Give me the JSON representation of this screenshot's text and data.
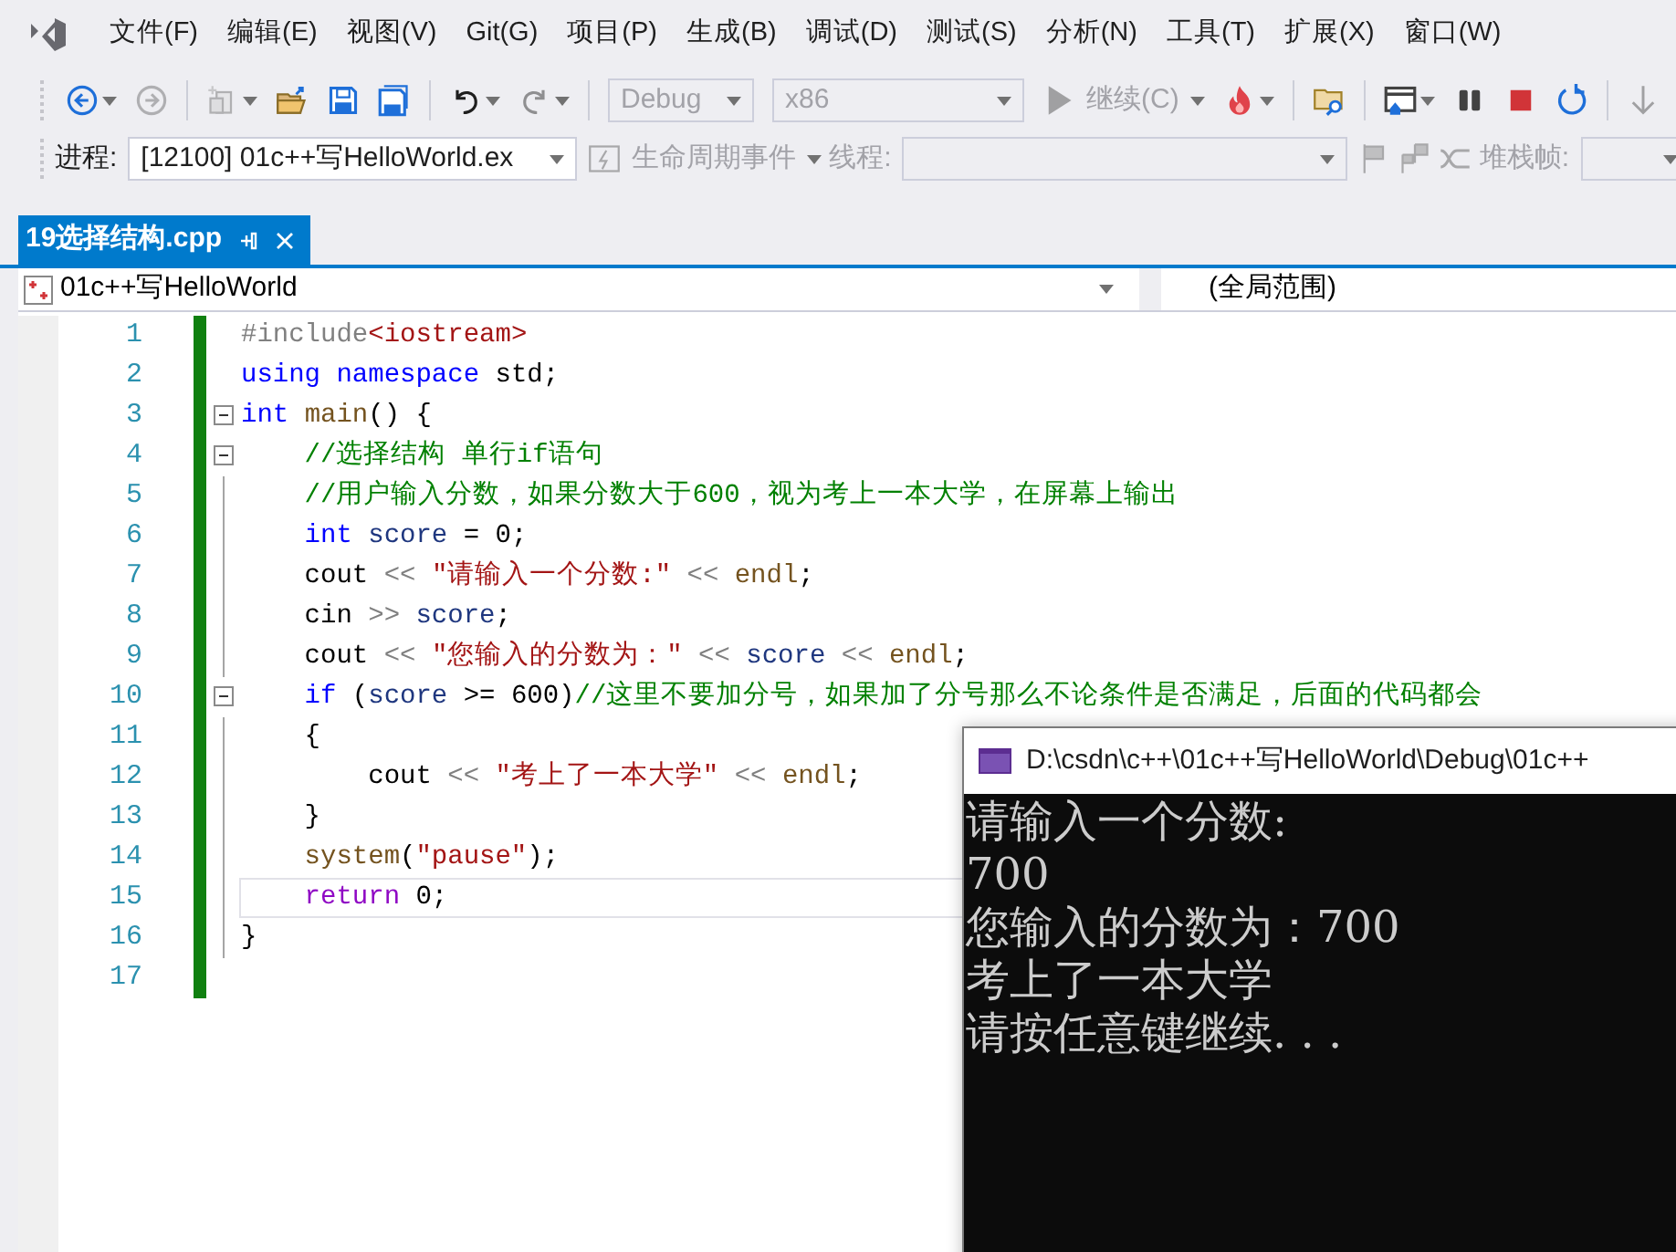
{
  "menu": [
    "文件(F)",
    "编辑(E)",
    "视图(V)",
    "Git(G)",
    "项目(P)",
    "生成(B)",
    "调试(D)",
    "测试(S)",
    "分析(N)",
    "工具(T)",
    "扩展(X)",
    "窗口(W)"
  ],
  "toolbar": {
    "row_1": [
      {
        "kind": "icon",
        "disabled": false,
        "dropdown": true
      },
      {
        "kind": "icon",
        "disabled": true,
        "dropdown": false
      },
      {
        "kind": "separator"
      },
      {
        "kind": "icon",
        "disabled": true,
        "dropdown": true
      },
      {
        "kind": "icon",
        "disabled": false,
        "dropdown": false
      },
      {
        "kind": "icon",
        "disabled": false,
        "dropdown": false
      },
      {
        "kind": "icon",
        "disabled": false,
        "dropdown": false
      },
      {
        "kind": "separator"
      },
      {
        "kind": "icon",
        "disabled": false,
        "dropdown": true
      },
      {
        "kind": "icon",
        "disabled": true,
        "dropdown": true
      },
      {
        "kind": "separator"
      },
      {
        "kind": "select",
        "value": "Debug",
        "disabled": true
      },
      {
        "kind": "select",
        "value": "x86",
        "disabled": true
      },
      {
        "kind": "text-button",
        "label": "继续(C)",
        "disabled": true,
        "dropdown": true
      },
      {
        "kind": "icon",
        "disabled": false,
        "dropdown": true
      },
      {
        "kind": "separator"
      },
      {
        "kind": "icon",
        "disabled": false,
        "dropdown": false
      },
      {
        "kind": "separator"
      },
      {
        "kind": "icon",
        "disabled": false,
        "dropdown": true
      },
      {
        "kind": "icon",
        "disabled": false,
        "dropdown": false
      },
      {
        "kind": "icon",
        "disabled": false,
        "dropdown": false
      },
      {
        "kind": "icon",
        "disabled": false,
        "dropdown": false
      },
      {
        "kind": "separator"
      },
      {
        "kind": "icon",
        "disabled": true,
        "dropdown": false
      }
    ],
    "row_2": [
      {
        "kind": "label",
        "label": "进程:",
        "disabled": false
      },
      {
        "kind": "select",
        "value": "[12100] 01c++写HelloWorld.ex",
        "disabled": false
      },
      {
        "kind": "text-button",
        "label": "生命周期事件",
        "disabled": true,
        "dropdown": true
      },
      {
        "kind": "label",
        "label": "线程:",
        "disabled": true
      },
      {
        "kind": "select",
        "disabled": true
      },
      {
        "kind": "icon",
        "disabled": true,
        "dropdown": false
      },
      {
        "kind": "icon",
        "disabled": true,
        "dropdown": false
      },
      {
        "kind": "icon",
        "disabled": true,
        "dropdown": false
      },
      {
        "kind": "label",
        "label": "堆栈帧:",
        "disabled": true
      },
      {
        "kind": "select",
        "disabled": true
      }
    ]
  },
  "document_tab": {
    "title": "19选择结构.cpp",
    "selected": true
  },
  "navigation_bar": {
    "project": "01c++写HelloWorld",
    "scope": "(全局范围)"
  },
  "editor": {
    "lines": [
      {
        "number": "1",
        "fold_marker": false,
        "current": false,
        "tokens": [
          {
            "kind": "preprocessor",
            "text": "#include"
          },
          {
            "kind": "include",
            "text": "<iostream>"
          }
        ]
      },
      {
        "number": "2",
        "fold_marker": false,
        "current": false,
        "tokens": [
          {
            "kind": "keyword",
            "text": "using "
          },
          {
            "kind": "keyword",
            "text": "namespace"
          },
          {
            "kind": "plain",
            "text": " std;"
          }
        ]
      },
      {
        "number": "3",
        "fold_marker": true,
        "current": false,
        "tokens": [
          {
            "kind": "keyword",
            "text": "int "
          },
          {
            "kind": "function",
            "text": "main"
          },
          {
            "kind": "plain",
            "text": "() {"
          }
        ]
      },
      {
        "number": "4",
        "fold_marker": true,
        "current": false,
        "tokens": [
          {
            "kind": "comment",
            "text": "    //选择结构 单行if语句"
          }
        ]
      },
      {
        "number": "5",
        "fold_marker": false,
        "current": false,
        "tokens": [
          {
            "kind": "comment",
            "text": "    //用户输入分数，如果分数大于600，视为考上一本大学，在屏幕上输出"
          }
        ]
      },
      {
        "number": "6",
        "fold_marker": false,
        "current": false,
        "tokens": [
          {
            "kind": "keyword",
            "text": "    int "
          },
          {
            "kind": "variable",
            "text": "score"
          },
          {
            "kind": "plain",
            "text": " = 0;"
          }
        ]
      },
      {
        "number": "7",
        "fold_marker": false,
        "current": false,
        "tokens": [
          {
            "kind": "plain",
            "text": "    cout "
          },
          {
            "kind": "operator",
            "text": "<< "
          },
          {
            "kind": "string",
            "text": "\"请输入一个分数:\" "
          },
          {
            "kind": "operator",
            "text": "<< "
          },
          {
            "kind": "function",
            "text": "endl"
          },
          {
            "kind": "plain",
            "text": ";"
          }
        ]
      },
      {
        "number": "8",
        "fold_marker": false,
        "current": false,
        "tokens": [
          {
            "kind": "plain",
            "text": "    cin "
          },
          {
            "kind": "operator",
            "text": ">> "
          },
          {
            "kind": "variable",
            "text": "score"
          },
          {
            "kind": "plain",
            "text": ";"
          }
        ]
      },
      {
        "number": "9",
        "fold_marker": false,
        "current": false,
        "tokens": [
          {
            "kind": "plain",
            "text": "    cout "
          },
          {
            "kind": "operator",
            "text": "<< "
          },
          {
            "kind": "string",
            "text": "\"您输入的分数为：\" "
          },
          {
            "kind": "operator",
            "text": "<< "
          },
          {
            "kind": "variable",
            "text": "score "
          },
          {
            "kind": "operator",
            "text": "<< "
          },
          {
            "kind": "function",
            "text": "endl"
          },
          {
            "kind": "plain",
            "text": ";"
          }
        ]
      },
      {
        "number": "10",
        "fold_marker": true,
        "current": false,
        "tokens": [
          {
            "kind": "keyword",
            "text": "    if"
          },
          {
            "kind": "plain",
            "text": " ("
          },
          {
            "kind": "variable",
            "text": "score"
          },
          {
            "kind": "plain",
            "text": " >= 600)"
          },
          {
            "kind": "comment",
            "text": "//这里不要加分号，如果加了分号那么不论条件是否满足，后面的代码都会"
          }
        ]
      },
      {
        "number": "11",
        "fold_marker": false,
        "current": false,
        "tokens": [
          {
            "kind": "plain",
            "text": "    {"
          }
        ]
      },
      {
        "number": "12",
        "fold_marker": false,
        "current": false,
        "tokens": [
          {
            "kind": "plain",
            "text": "        cout "
          },
          {
            "kind": "operator",
            "text": "<< "
          },
          {
            "kind": "string",
            "text": "\"考上了一本大学\" "
          },
          {
            "kind": "operator",
            "text": "<< "
          },
          {
            "kind": "function",
            "text": "endl"
          },
          {
            "kind": "plain",
            "text": ";"
          }
        ]
      },
      {
        "number": "13",
        "fold_marker": false,
        "current": false,
        "tokens": [
          {
            "kind": "plain",
            "text": "    }"
          }
        ]
      },
      {
        "number": "14",
        "fold_marker": false,
        "current": false,
        "tokens": [
          {
            "kind": "function",
            "text": "    system"
          },
          {
            "kind": "plain",
            "text": "("
          },
          {
            "kind": "string",
            "text": "\"pause\""
          },
          {
            "kind": "plain",
            "text": ");"
          }
        ]
      },
      {
        "number": "15",
        "fold_marker": false,
        "current": true,
        "tokens": [
          {
            "kind": "control",
            "text": "    return"
          },
          {
            "kind": "plain",
            "text": " 0;"
          }
        ]
      },
      {
        "number": "16",
        "fold_marker": false,
        "current": false,
        "tokens": [
          {
            "kind": "plain",
            "text": "}"
          }
        ]
      },
      {
        "number": "17",
        "fold_marker": false,
        "current": false
      }
    ]
  },
  "console": {
    "title": "D:\\csdn\\c++\\01c++写HelloWorld\\Debug\\01c++",
    "lines": [
      "请输入一个分数:",
      "700",
      "您输入的分数为：700",
      "考上了一本大学",
      "请按任意键继续. . ."
    ]
  }
}
